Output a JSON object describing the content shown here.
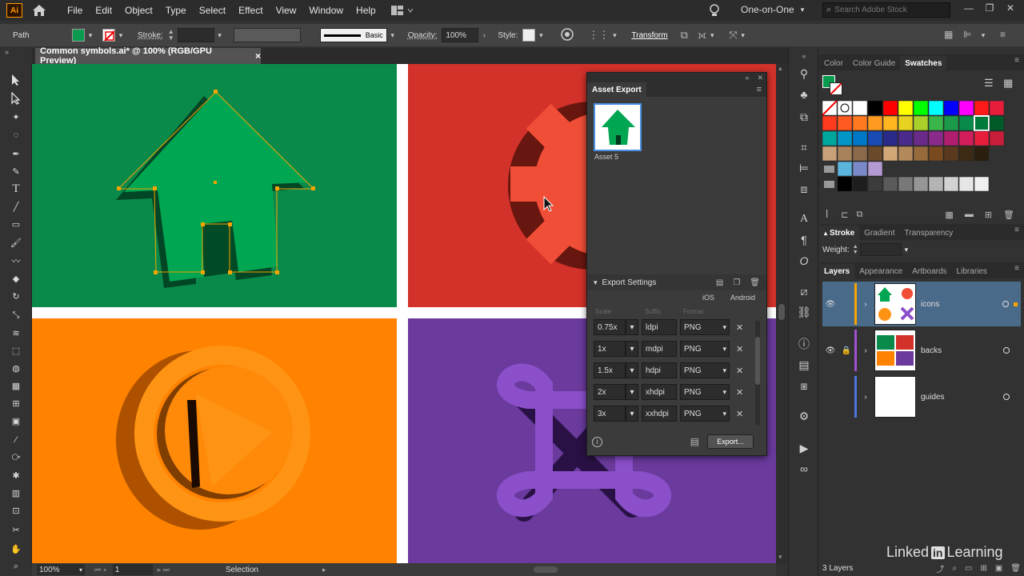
{
  "app": {
    "logo": "Ai",
    "workspace": "One-on-One",
    "search_placeholder": "Search Adobe Stock"
  },
  "menu": [
    "File",
    "Edit",
    "Object",
    "Type",
    "Select",
    "Effect",
    "View",
    "Window",
    "Help"
  ],
  "control": {
    "selection_type": "Path",
    "stroke_label": "Stroke:",
    "brush": "Basic",
    "opacity_label": "Opacity:",
    "opacity": "100%",
    "style_label": "Style:",
    "transform": "Transform"
  },
  "document": {
    "tab_title": "Common symbols.ai* @ 100% (RGB/GPU Preview)",
    "close": "×"
  },
  "status": {
    "zoom": "100%",
    "artboard": "1",
    "tool": "Selection"
  },
  "colors": {
    "green": "#0a8a4a",
    "red": "#d2322a",
    "orange": "#ff8200",
    "purple": "#6a3a9c",
    "house": "#00a651",
    "gear": "#f04e37",
    "play": "#ff9414",
    "cmd": "#8a4fc9",
    "selection": "#f7a300"
  },
  "asset_export": {
    "title": "Asset Export",
    "asset_name": "Asset 5",
    "export_settings": "Export Settings",
    "ios": "iOS",
    "android": "Android",
    "col_scale": "Scale",
    "col_suffix": "Suffix",
    "col_format": "Format",
    "rows": [
      {
        "scale": "0.75x",
        "suffix": "ldpi",
        "format": "PNG"
      },
      {
        "scale": "1x",
        "suffix": "mdpi",
        "format": "PNG"
      },
      {
        "scale": "1.5x",
        "suffix": "hdpi",
        "format": "PNG"
      },
      {
        "scale": "2x",
        "suffix": "xhdpi",
        "format": "PNG"
      },
      {
        "scale": "3x",
        "suffix": "xxhdpi",
        "format": "PNG"
      }
    ],
    "export_button": "Export..."
  },
  "panels": {
    "color_tabs": [
      "Color",
      "Color Guide",
      "Swatches"
    ],
    "stroke_tabs": [
      "Stroke",
      "Gradient",
      "Transparency"
    ],
    "weight_label": "Weight:",
    "layer_tabs": [
      "Layers",
      "Appearance",
      "Artboards",
      "Libraries"
    ],
    "layers": [
      {
        "name": "icons",
        "color": "#f7a300"
      },
      {
        "name": "backs",
        "color": "#a050d0"
      },
      {
        "name": "guides",
        "color": "#4a78e0"
      }
    ],
    "layers_count": "3 Layers"
  },
  "watermark": {
    "brand": "Linked",
    "in": "in",
    "suffix": "Learning"
  }
}
